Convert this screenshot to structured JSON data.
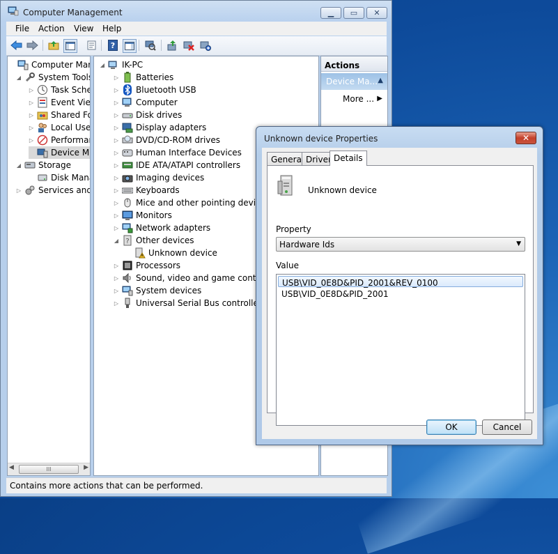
{
  "window": {
    "title": "Computer Management",
    "minimize": "▁",
    "maximize": "▭",
    "close": "✕"
  },
  "menu": [
    "File",
    "Action",
    "View",
    "Help"
  ],
  "left_tree": [
    {
      "label": "Computer Manag",
      "icon": "computer-management-icon",
      "level": 0,
      "expander": ""
    },
    {
      "label": "System Tools",
      "icon": "system-tools-icon",
      "level": 1,
      "expander": "◢"
    },
    {
      "label": "Task Sche",
      "icon": "task-scheduler-icon",
      "level": 2,
      "expander": "▷"
    },
    {
      "label": "Event View",
      "icon": "event-viewer-icon",
      "level": 2,
      "expander": "▷"
    },
    {
      "label": "Shared Fo",
      "icon": "shared-folders-icon",
      "level": 2,
      "expander": "▷"
    },
    {
      "label": "Local User",
      "icon": "local-users-icon",
      "level": 2,
      "expander": "▷"
    },
    {
      "label": "Performar",
      "icon": "performance-icon",
      "level": 2,
      "expander": "▷"
    },
    {
      "label": "Device Ma",
      "icon": "device-manager-icon",
      "level": 2,
      "expander": ""
    },
    {
      "label": "Storage",
      "icon": "storage-icon",
      "level": 1,
      "expander": "◢"
    },
    {
      "label": "Disk Mana",
      "icon": "disk-management-icon",
      "level": 2,
      "expander": ""
    },
    {
      "label": "Services and A",
      "icon": "services-icon",
      "level": 1,
      "expander": "▷"
    }
  ],
  "left_scroll": {
    "thumb": "III",
    "left": "◀",
    "right": "▶"
  },
  "device_tree": {
    "root": "IK-PC",
    "items": [
      {
        "label": "Batteries",
        "icon": "battery-icon",
        "expander": "▷"
      },
      {
        "label": "Bluetooth USB",
        "icon": "bluetooth-icon",
        "expander": "▷"
      },
      {
        "label": "Computer",
        "icon": "computer-icon",
        "expander": "▷"
      },
      {
        "label": "Disk drives",
        "icon": "disk-drive-icon",
        "expander": "▷"
      },
      {
        "label": "Display adapters",
        "icon": "display-adapter-icon",
        "expander": "▷"
      },
      {
        "label": "DVD/CD-ROM drives",
        "icon": "dvd-drive-icon",
        "expander": "▷"
      },
      {
        "label": "Human Interface Devices",
        "icon": "hid-icon",
        "expander": "▷"
      },
      {
        "label": "IDE ATA/ATAPI controllers",
        "icon": "ide-controller-icon",
        "expander": "▷"
      },
      {
        "label": "Imaging devices",
        "icon": "camera-icon",
        "expander": "▷"
      },
      {
        "label": "Keyboards",
        "icon": "keyboard-icon",
        "expander": "▷"
      },
      {
        "label": "Mice and other pointing devices",
        "icon": "mouse-icon",
        "expander": "▷"
      },
      {
        "label": "Monitors",
        "icon": "monitor-icon",
        "expander": "▷"
      },
      {
        "label": "Network adapters",
        "icon": "network-adapter-icon",
        "expander": "▷"
      },
      {
        "label": "Other devices",
        "icon": "other-devices-icon",
        "expander": "◢"
      },
      {
        "label": "Unknown device",
        "icon": "unknown-device-warning-icon",
        "expander": "",
        "child": true
      },
      {
        "label": "Processors",
        "icon": "processor-icon",
        "expander": "▷"
      },
      {
        "label": "Sound, video and game controll",
        "icon": "sound-icon",
        "expander": "▷"
      },
      {
        "label": "System devices",
        "icon": "system-devices-icon",
        "expander": "▷"
      },
      {
        "label": "Universal Serial Bus controllers",
        "icon": "usb-icon",
        "expander": "▷"
      }
    ]
  },
  "actions": {
    "header": "Actions",
    "section": "Device Ma...",
    "section_arrow": "▲",
    "more": "More ...",
    "more_arrow": "▶"
  },
  "status": "Contains more actions that can be performed.",
  "dialog": {
    "title": "Unknown device Properties",
    "close": "✕",
    "tabs": [
      "General",
      "Driver",
      "Details"
    ],
    "active_tab": "Details",
    "device_name": "Unknown device",
    "property_label": "Property",
    "property_value": "Hardware Ids",
    "dropdown_arrow": "▼",
    "value_label": "Value",
    "values": [
      "USB\\VID_0E8D&PID_2001&REV_0100",
      "USB\\VID_0E8D&PID_2001"
    ],
    "ok": "OK",
    "cancel": "Cancel"
  },
  "colors": {
    "window_frame": "#b9d1ee",
    "selection": "#dbeafc",
    "desktop": "#1c64b6",
    "actions_selected": "#9dc1e6"
  }
}
